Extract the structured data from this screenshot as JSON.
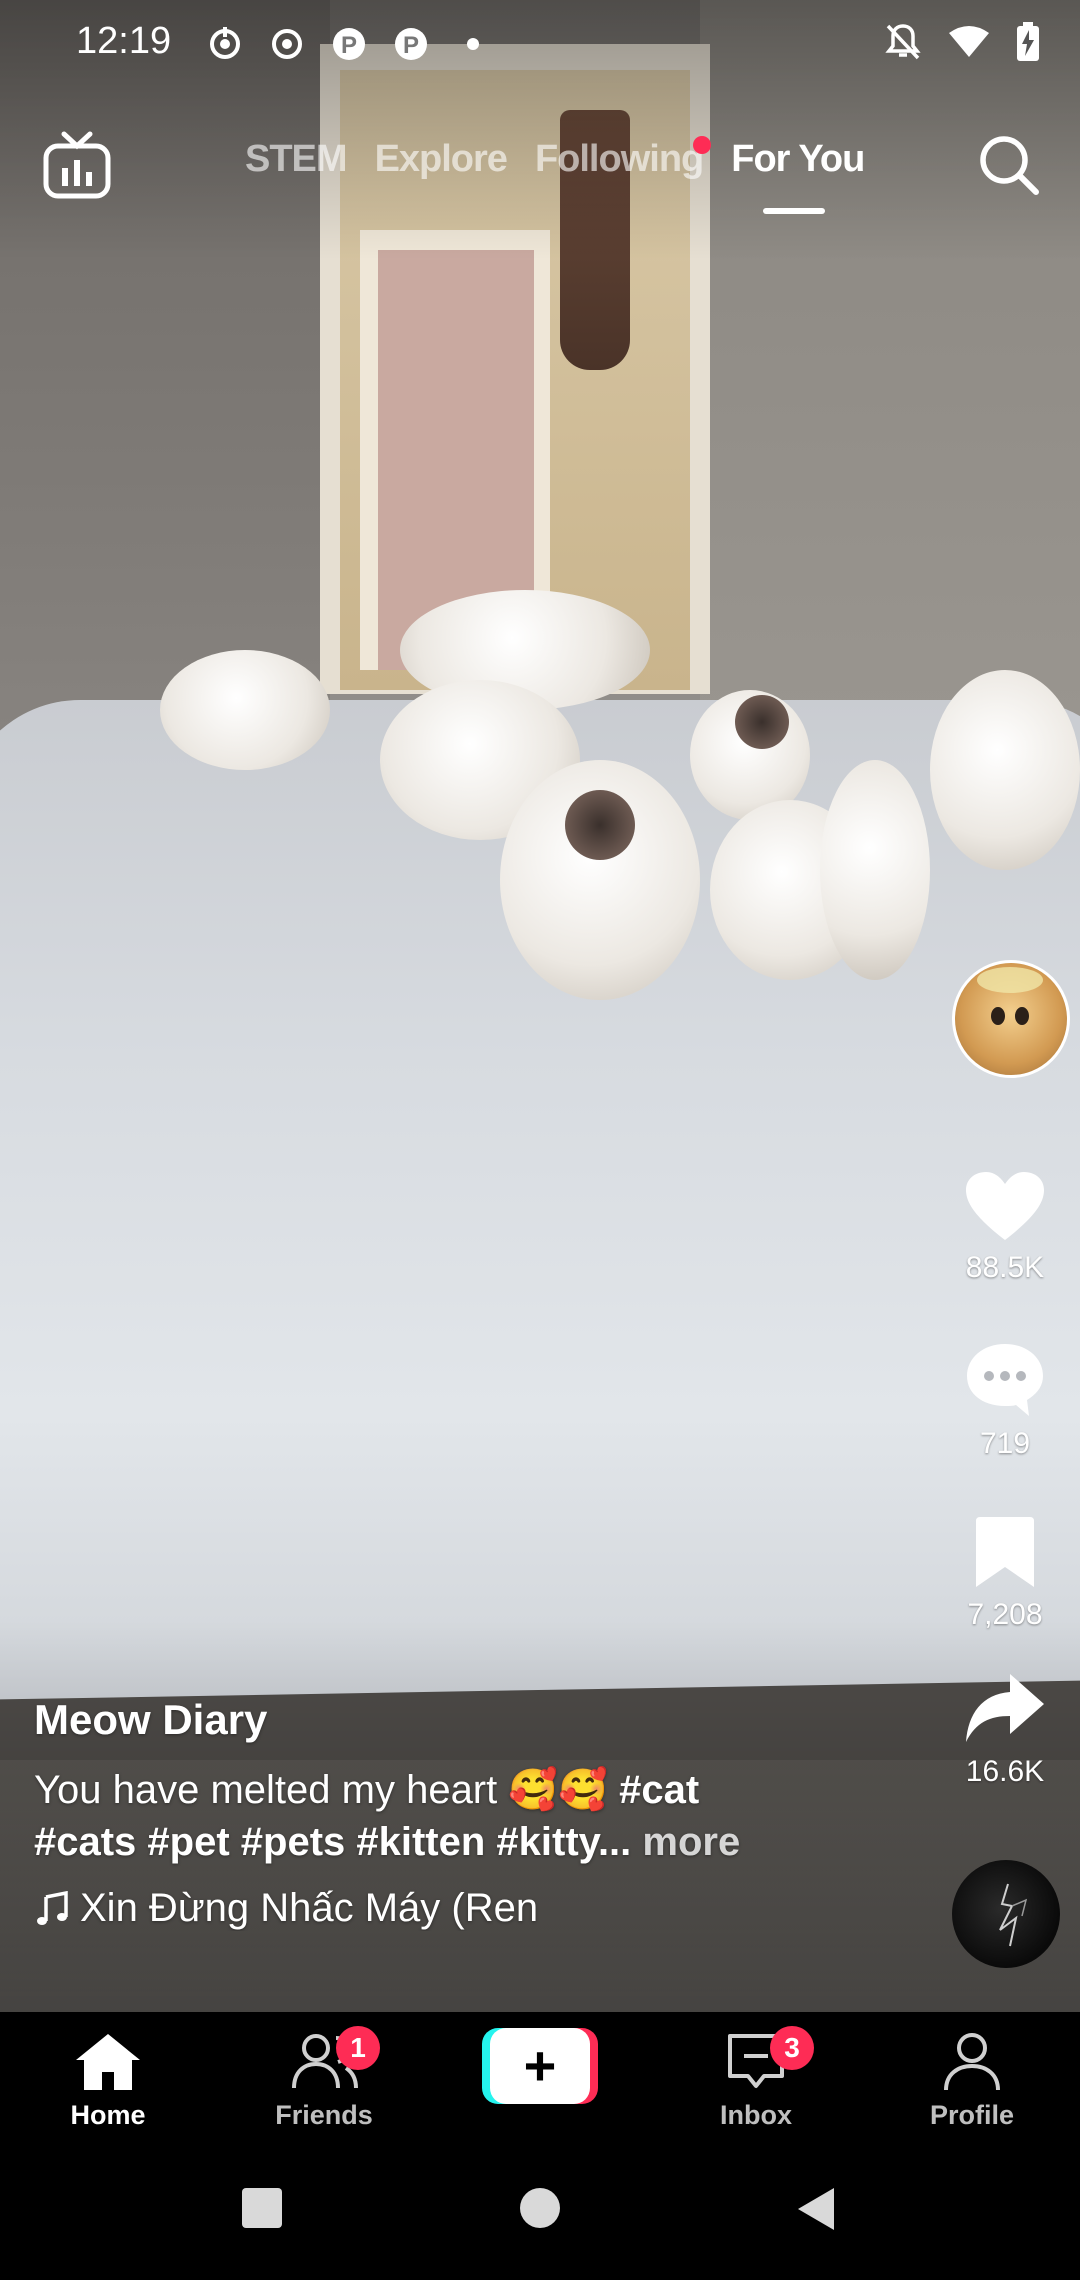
{
  "status_bar": {
    "time": "12:19",
    "left_icons": [
      "ring-progress-icon",
      "record-icon",
      "pinterest-icon",
      "pinterest-icon",
      "dot-icon"
    ],
    "right_icons": [
      "mute-icon",
      "wifi-icon",
      "battery-charging-icon"
    ]
  },
  "top_nav": {
    "tabs": [
      {
        "label": "STEM",
        "active": false
      },
      {
        "label": "Explore",
        "active": false
      },
      {
        "label": "Following",
        "active": false,
        "has_dot": true
      },
      {
        "label": "For You",
        "active": true
      }
    ]
  },
  "rail": {
    "likes": "88.5K",
    "comments": "719",
    "saves": "7,208",
    "shares": "16.6K"
  },
  "post": {
    "author": "Meow Diary",
    "description_text": "You have melted my heart 🥰🥰",
    "description_tags_line1": "#cat",
    "description_tags_line2": "#cats #pet #pets #kitten #kitty...",
    "more_label": "more",
    "music": "Xin Đừng Nhấc Máy (Ren"
  },
  "bottom_nav": {
    "items": [
      {
        "label": "Home",
        "active": true
      },
      {
        "label": "Friends",
        "badge": "1"
      },
      {
        "label": "Inbox",
        "badge": "3"
      },
      {
        "label": "Profile"
      }
    ]
  },
  "colors": {
    "accent_red": "#fe2c55",
    "accent_cyan": "#25f4ee"
  }
}
